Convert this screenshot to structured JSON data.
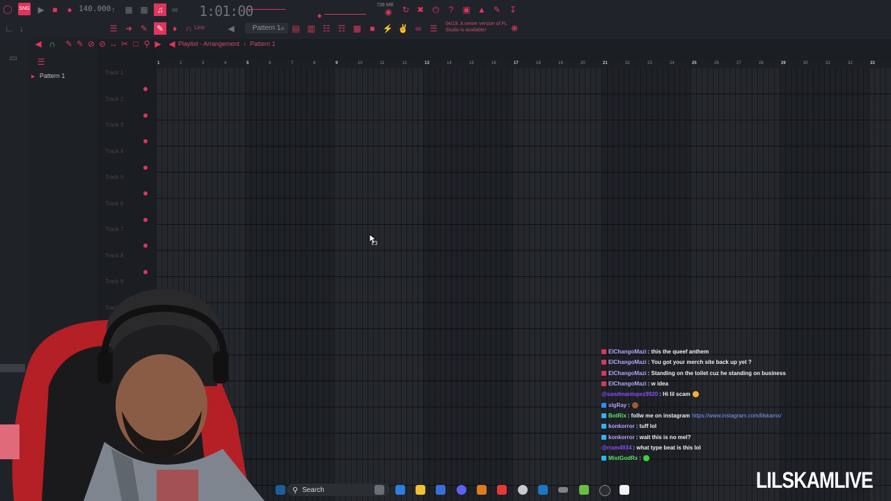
{
  "app": {
    "tempo": "140.000",
    "time": "1:01:00",
    "memory": "738 MB",
    "update_notice": "04/19: A newer version of FL Studio is available!",
    "snap_mode": "Line",
    "pattern_selector": "Pattern 1",
    "accent_color": "#e0355c"
  },
  "breadcrumb": {
    "title": "Playlist - Arrangement",
    "separator": "›",
    "current": "Pattern 1"
  },
  "pattern_list": [
    {
      "label": "Pattern 1"
    }
  ],
  "tracks": [
    {
      "label": "Track 1"
    },
    {
      "label": "Track 2"
    },
    {
      "label": "Track 3"
    },
    {
      "label": "Track 4"
    },
    {
      "label": "Track 5"
    },
    {
      "label": "Track 6"
    },
    {
      "label": "Track 7"
    },
    {
      "label": "Track 8"
    },
    {
      "label": "Track 9"
    },
    {
      "label": "Track 10"
    }
  ],
  "ruler_marks": [
    "1",
    "2",
    "3",
    "4",
    "5",
    "6",
    "7",
    "8",
    "9",
    "10",
    "11",
    "12",
    "13",
    "14",
    "15",
    "16",
    "17",
    "18",
    "19",
    "20",
    "21",
    "22",
    "23",
    "24",
    "25",
    "26",
    "27",
    "28",
    "29",
    "30",
    "31",
    "32",
    "33"
  ],
  "chat": [
    {
      "user": "ElChangoMazi",
      "user_color": "#b9a2ff",
      "message": ": this the queef anthem",
      "badge": "#e0355c"
    },
    {
      "user": "ElChangoMazi",
      "user_color": "#b9a2ff",
      "message": ": You got your merch site back up yet ?",
      "badge": "#e0355c"
    },
    {
      "user": "ElChangoMazi",
      "user_color": "#b9a2ff",
      "message": ": Standing on the toilet cuz he standing on business",
      "badge": "#e0355c"
    },
    {
      "user": "ElChangoMazi",
      "user_color": "#b9a2ff",
      "message": ": w idea",
      "badge": "#e0355c"
    },
    {
      "user": "@sandmanlopez9920",
      "user_color": "#8a4fff",
      "message": ": Hi lil scam",
      "badge": "",
      "emote": "#f2b233"
    },
    {
      "user": "slgRay",
      "user_color": "#b9a2ff",
      "message": ":",
      "badge": "#2b8cff",
      "emote": "#a05a3a"
    },
    {
      "user": "BotRix",
      "user_color": "#5fe06e",
      "message": ": follw me on instagram",
      "link": "https://www.instagram.com/lilskamx/",
      "badge": "#2bb4ff"
    },
    {
      "user": "konkorror",
      "user_color": "#b9a2ff",
      "message": ": tuff lol",
      "badge": "#2bb4ff"
    },
    {
      "user": "konkorror",
      "user_color": "#b9a2ff",
      "message": ": wait this is no mel?",
      "badge": "#2bb4ff"
    },
    {
      "user": "@rram4934",
      "user_color": "#8a4fff",
      "message": ": what type beat is this lol",
      "badge": ""
    },
    {
      "user": "MistGodRx",
      "user_color": "#5fe06e",
      "message": ":",
      "badge": "#2bb4ff",
      "emote": "#3ed13e"
    }
  ],
  "taskbar": {
    "search_label": "Search"
  },
  "overlay_brand": "LILSKAMLIVE"
}
